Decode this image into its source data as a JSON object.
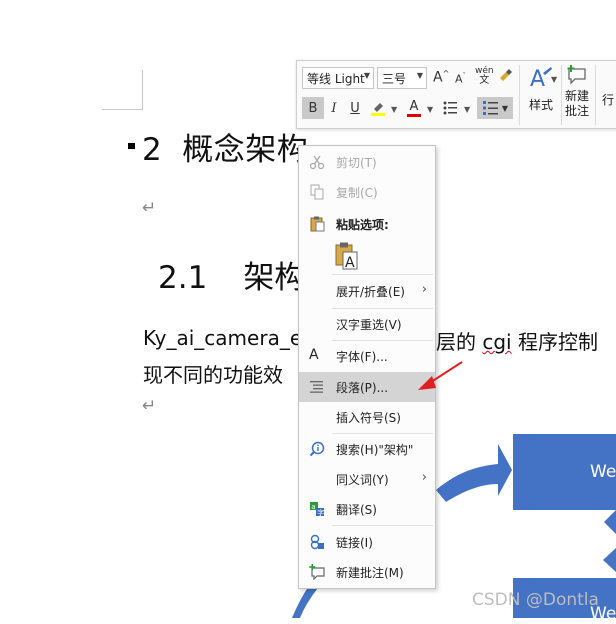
{
  "document": {
    "heading2_num": "2",
    "heading2_text": "概念架构",
    "heading3_num": "2.1",
    "heading3_text": "架构",
    "para_mark": "↵",
    "body_line1_a": "Ky_ai_camera_e",
    "body_line1_b": "层的 ",
    "body_line1_cgi": "cgi",
    "body_line1_c": " 程序控制",
    "body_line2": "现不同的功能效",
    "box1_text": "We",
    "box2_text": "We",
    "watermark": "CSDN @Dontla"
  },
  "toolbar": {
    "font_name": "等线 Light",
    "font_size": "三号",
    "grow_font": "A",
    "shrink_font": "A",
    "phonetic": "wén",
    "bold": "B",
    "italic": "I",
    "underline": "U",
    "font_color": "A",
    "styles_label": "样式",
    "new_comment_line1": "新建",
    "new_comment_line2": "批注",
    "line_spacing_label": "行"
  },
  "context_menu": {
    "items": [
      {
        "label": "剪切(T)",
        "icon": "scissors-icon",
        "enabled": false
      },
      {
        "label": "复制(C)",
        "icon": "copy-icon",
        "enabled": false
      },
      {
        "label": "粘贴选项:",
        "icon": "clipboard-icon",
        "enabled": true
      },
      {
        "label": "展开/折叠(E)",
        "icon": "",
        "enabled": true,
        "submenu": true
      },
      {
        "label": "汉字重选(V)",
        "icon": "",
        "enabled": true
      },
      {
        "label": "字体(F)...",
        "icon": "font-icon",
        "enabled": true
      },
      {
        "label": "段落(P)...",
        "icon": "paragraph-icon",
        "enabled": true,
        "highlighted": true
      },
      {
        "label": "插入符号(S)",
        "icon": "",
        "enabled": true
      },
      {
        "label": "搜索(H)\"架构\"",
        "icon": "smart-lookup-icon",
        "enabled": true
      },
      {
        "label": "同义词(Y)",
        "icon": "",
        "enabled": true,
        "submenu": true
      },
      {
        "label": "翻译(S)",
        "icon": "translate-icon",
        "enabled": true
      },
      {
        "label": "链接(I)",
        "icon": "link-icon",
        "enabled": true
      },
      {
        "label": "新建批注(M)",
        "icon": "new-comment-icon",
        "enabled": true
      }
    ],
    "paste_keep_text_letter": "A"
  },
  "colors": {
    "accent_blue": "#4472c4",
    "menu_highlight": "#d4d4d4",
    "annotation_red": "#e02020",
    "font_color_red": "#e00000",
    "highlight_yellow": "#ffff00"
  }
}
